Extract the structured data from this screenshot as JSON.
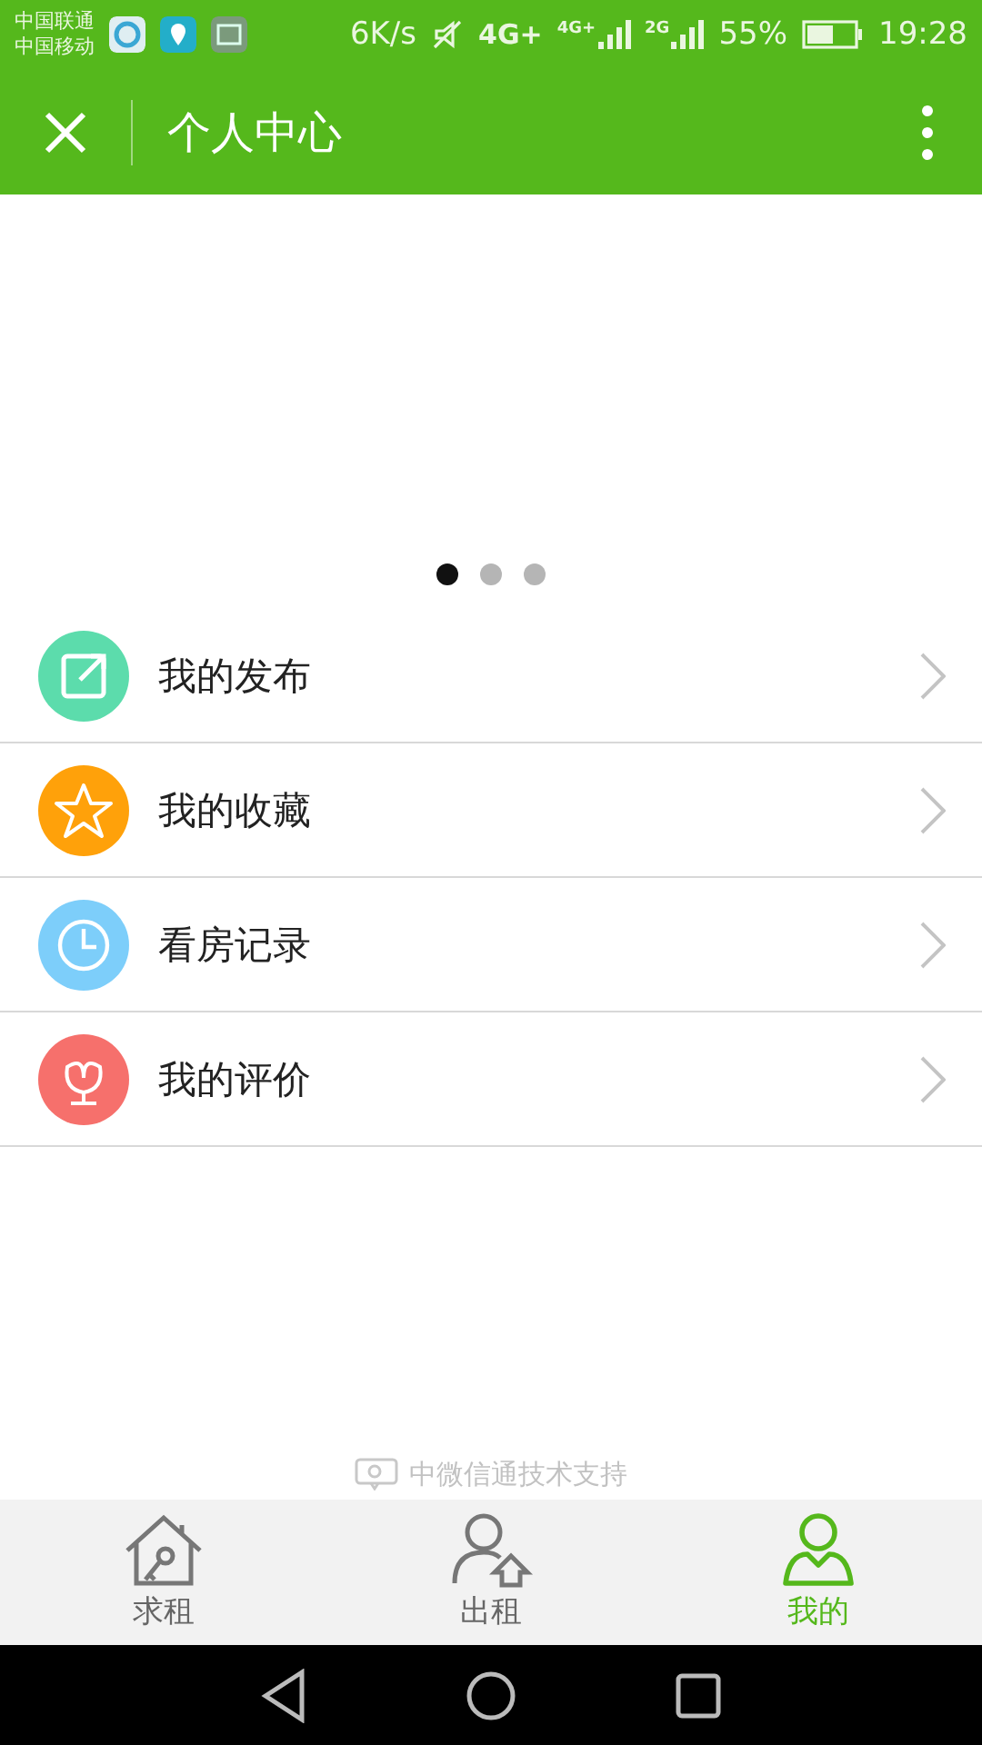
{
  "status_bar": {
    "carriers": [
      "中国联通",
      "中国移动"
    ],
    "speed": "6K/s",
    "network": "4G+",
    "signals": [
      {
        "label": "4G+"
      },
      {
        "label": "2G"
      }
    ],
    "battery": "55%",
    "time": "19:28"
  },
  "header": {
    "title": "个人中心"
  },
  "carousel": {
    "dots": [
      {
        "selected": true
      },
      {
        "selected": false
      },
      {
        "selected": false
      }
    ]
  },
  "menu": [
    {
      "label": "我的发布",
      "kind": "edit",
      "color": "#5cdcac"
    },
    {
      "label": "我的收藏",
      "kind": "star",
      "color": "#ffa10a"
    },
    {
      "label": "看房记录",
      "kind": "clock",
      "color": "#7dcefa"
    },
    {
      "label": "我的评价",
      "kind": "flower",
      "color": "#f6706c"
    }
  ],
  "footer": {
    "text": "中微信通技术支持"
  },
  "tabs": [
    {
      "label": "求租",
      "kind": "house",
      "selected": false
    },
    {
      "label": "出租",
      "kind": "landlord",
      "selected": false
    },
    {
      "label": "我的",
      "kind": "person",
      "selected": true
    }
  ]
}
